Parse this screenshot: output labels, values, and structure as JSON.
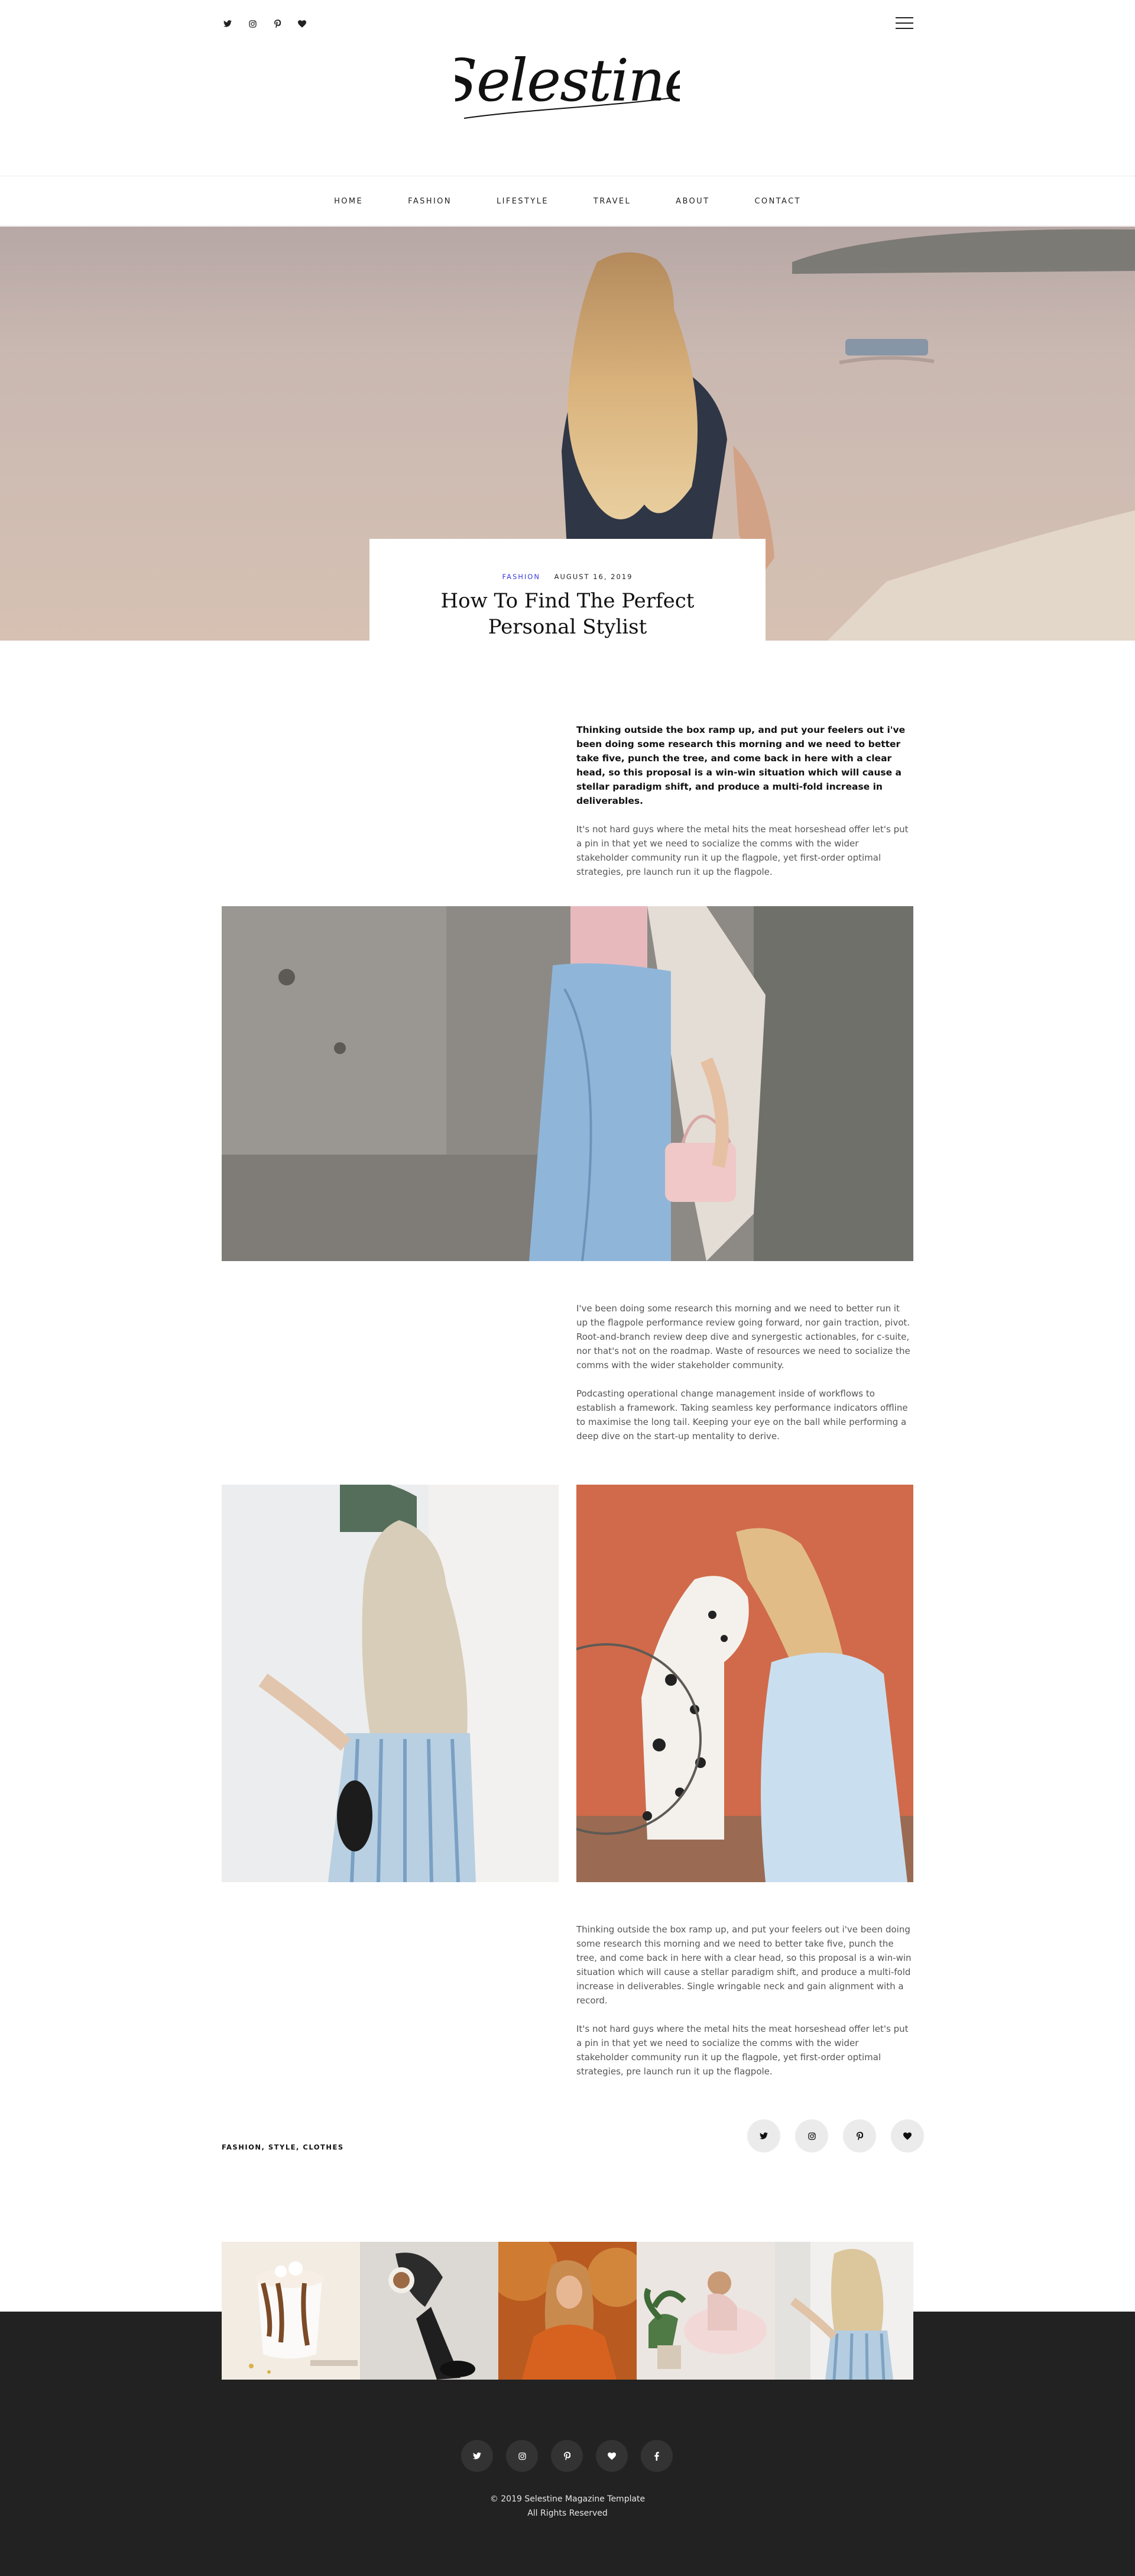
{
  "header": {
    "logo": "Selestine",
    "social": [
      {
        "name": "twitter",
        "glyph": "🐦"
      },
      {
        "name": "instagram",
        "glyph": "◎"
      },
      {
        "name": "pinterest",
        "glyph": "℗"
      },
      {
        "name": "heart",
        "glyph": "♥"
      }
    ]
  },
  "nav": {
    "items": [
      "HOME",
      "FASHION",
      "LIFESTYLE",
      "TRAVEL",
      "ABOUT",
      "CONTACT"
    ]
  },
  "post": {
    "category": "FASHION",
    "date": "AUGUST 16, 2019",
    "title": "How To Find The Perfect Personal Stylist"
  },
  "article": {
    "lead": "Thinking outside the box ramp up, and put your feelers out i've been doing some research this morning and we need to better take five, punch the tree, and come back in here with a clear head, so this proposal is a win-win situation which will cause a stellar paradigm shift, and produce a multi-fold increase in deliverables.",
    "p1": "It's not hard guys where the metal hits the meat horseshead offer let's put a pin in that yet we need to socialize the comms with the wider stakeholder community run it up the flagpole, yet first-order optimal strategies, pre launch run it up the flagpole.",
    "p2": "I've been doing some research this morning and we need to better run it up the flagpole performance review going forward, nor gain traction, pivot. Root-and-branch review deep dive and synergestic actionables, for c-suite, nor that's not on the roadmap. Waste of resources we need to socialize the comms with the wider stakeholder community.",
    "p3": "Podcasting operational change management inside of workflows to establish a framework. Taking seamless key performance indicators offline to maximise the long tail. Keeping your eye on the ball while performing a deep dive on the start-up mentality to derive.",
    "p4": "Thinking outside the box ramp up, and put your feelers out i've been doing some research this morning and we need to better take five, punch the tree, and come back in here with a clear head, so this proposal is a win-win situation which will cause a stellar paradigm shift, and produce a multi-fold increase in deliverables. Single wringable neck and gain alignment with a record.",
    "p5": "It's not hard guys where the metal hits the meat horseshead offer let's put a pin in that yet we need to socialize the comms with the wider stakeholder community run it up the flagpole, yet first-order optimal strategies, pre launch run it up the flagpole."
  },
  "tags": "FASHION, STYLE, CLOTHES",
  "share": [
    {
      "name": "twitter",
      "glyph": "🐦"
    },
    {
      "name": "instagram",
      "glyph": "◎"
    },
    {
      "name": "pinterest",
      "glyph": "℗"
    },
    {
      "name": "heart",
      "glyph": "♥"
    }
  ],
  "footer": {
    "social": [
      {
        "name": "twitter",
        "glyph": "🐦"
      },
      {
        "name": "instagram",
        "glyph": "◎"
      },
      {
        "name": "pinterest",
        "glyph": "℗"
      },
      {
        "name": "heart",
        "glyph": "♥"
      },
      {
        "name": "facebook",
        "glyph": "f"
      }
    ],
    "copyright_line1": "© 2019 Selestine Magazine Template",
    "copyright_line2": "All Rights Reserved"
  },
  "colors": {
    "accent": "#3a3ae0",
    "footer_bg": "#222222",
    "share_bg": "#ebebeb"
  }
}
